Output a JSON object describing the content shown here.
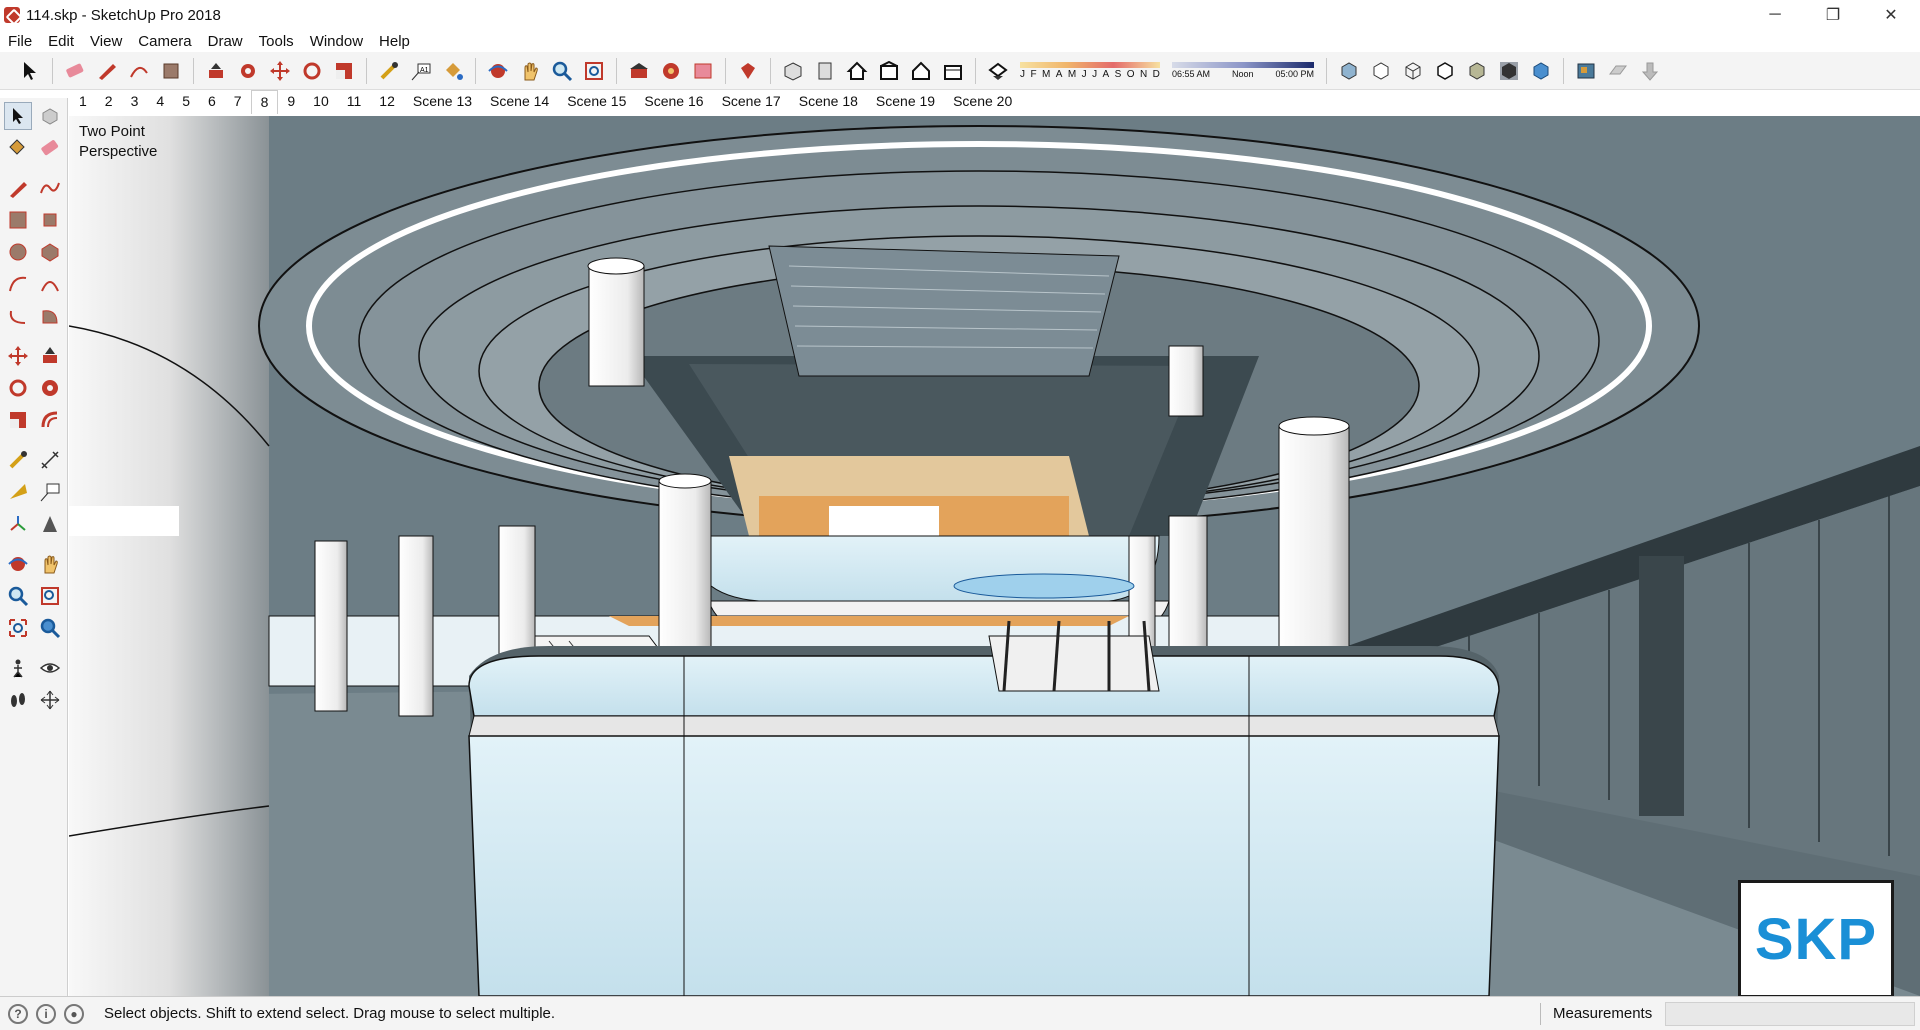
{
  "window": {
    "title": "114.skp - SketchUp Pro 2018",
    "controls": {
      "minimize": "─",
      "restore": "❐",
      "close": "✕"
    }
  },
  "menu": [
    "File",
    "Edit",
    "View",
    "Camera",
    "Draw",
    "Tools",
    "Window",
    "Help"
  ],
  "toolbar": {
    "shadow_months": [
      "J",
      "F",
      "M",
      "A",
      "M",
      "J",
      "J",
      "A",
      "S",
      "O",
      "N",
      "D"
    ],
    "time_start": "06:55 AM",
    "time_mid": "Noon",
    "time_end": "05:00 PM",
    "icons": [
      "select-icon",
      "eraser-icon",
      "pencil-icon",
      "arc-icon",
      "rectangle-icon",
      "push-pull-icon",
      "follow-me-icon",
      "move-icon",
      "rotate-icon",
      "scale-icon",
      "tape-measure-icon",
      "text-icon",
      "paint-bucket-icon",
      "orbit-icon",
      "pan-icon",
      "zoom-icon",
      "zoom-extents-icon",
      "warehouse-icon",
      "extension-warehouse-icon",
      "layout-icon",
      "ruby-icon",
      "iso-view-icon",
      "top-view-icon",
      "front-view-icon",
      "right-view-icon",
      "back-view-icon",
      "left-view-icon",
      "shadow-toggle-icon",
      "xray-icon",
      "back-edges-icon",
      "wireframe-icon",
      "hidden-line-icon",
      "shaded-icon",
      "shaded-textures-icon",
      "monochrome-icon",
      "section-plane-icon",
      "section-cut-icon",
      "section-fill-icon"
    ]
  },
  "scenes": [
    "1",
    "2",
    "3",
    "4",
    "5",
    "6",
    "7",
    "8",
    "9",
    "10",
    "11",
    "12",
    "Scene 13",
    "Scene 14",
    "Scene 15",
    "Scene 16",
    "Scene 17",
    "Scene 18",
    "Scene 19",
    "Scene 20"
  ],
  "active_scene": "8",
  "viewport": {
    "camera_label_line1": "Two Point",
    "camera_label_line2": "Perspective",
    "logo_text": "SKP"
  },
  "status": {
    "message": "Select objects. Shift to extend select. Drag mouse to select multiple.",
    "measurements_label": "Measurements",
    "measurements_value": ""
  },
  "colors": {
    "accent_blue": "#1a8fd6",
    "glass": "#cfe8f2",
    "wall": "#6e7f87",
    "wood": "#e3a35b"
  }
}
